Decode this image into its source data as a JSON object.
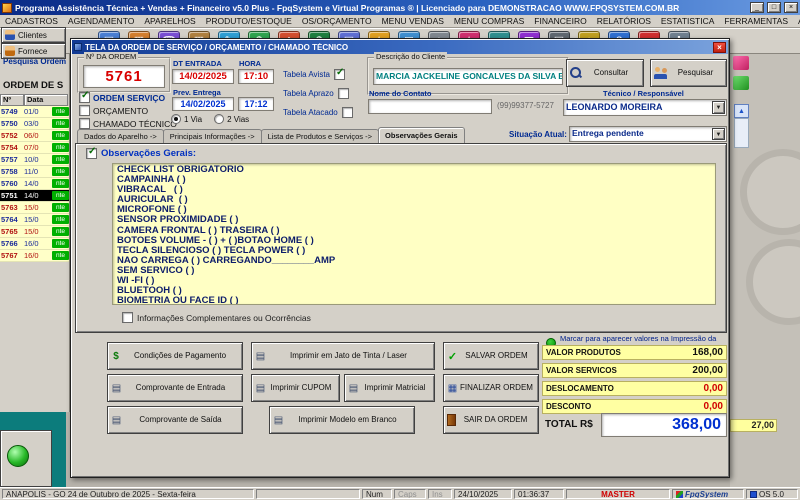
{
  "window": {
    "title": "Programa Assistência Técnica + Vendas + Financeiro v5.0 Plus - FpqSystem e Virtual Programas ® | Licenciado para  DEMONSTRACAO WWW.FPQSYSTEM.COM.BR",
    "controls": {
      "minimize": "_",
      "maximize": "□",
      "close": "×"
    }
  },
  "menu": {
    "items": [
      "CADASTROS",
      "AGENDAMENTO",
      "APARELHOS",
      "PRODUTO/ESTOQUE",
      "OS/ORÇAMENTO",
      "MENU VENDAS",
      "MENU COMPRAS",
      "FINANCEIRO",
      "RELATÓRIOS",
      "ESTATISTICA",
      "FERRAMENTAS",
      "AJUDA"
    ]
  },
  "toolbar": {
    "left_buttons": [
      {
        "label": "Clientes"
      },
      {
        "label": "Fornece"
      }
    ],
    "icons": [
      {
        "name": "agenda-icon",
        "glyph": "▤",
        "color": "#4a7fd4"
      },
      {
        "name": "calendar-icon",
        "glyph": "▦",
        "color": "#d47f2f"
      },
      {
        "name": "phone-icon",
        "glyph": "☎",
        "color": "#7a4fd4"
      },
      {
        "name": "stock-icon",
        "glyph": "▥",
        "color": "#b08040"
      },
      {
        "name": "order-icon",
        "glyph": "✎",
        "color": "#2f9fd4"
      },
      {
        "name": "sales-icon",
        "glyph": "$",
        "color": "#2fa44f"
      },
      {
        "name": "purchases-icon",
        "glyph": "◆",
        "color": "#d44f2f"
      },
      {
        "name": "finance-icon",
        "glyph": "$",
        "color": "#1f7f3f"
      },
      {
        "name": "reports-icon",
        "glyph": "▤",
        "color": "#5f6fd4"
      },
      {
        "name": "stats-icon",
        "glyph": "★",
        "color": "#e0a020"
      },
      {
        "name": "mail-icon",
        "glyph": "✉",
        "color": "#3f8fd0"
      },
      {
        "name": "tools-icon",
        "glyph": "+",
        "color": "#808890"
      },
      {
        "name": "star-icon",
        "glyph": "★",
        "color": "#d02f6f"
      },
      {
        "name": "home-icon",
        "glyph": "⌂",
        "color": "#2f8f8f"
      },
      {
        "name": "chart-icon",
        "glyph": "▆",
        "color": "#8f2fd0"
      },
      {
        "name": "print-icon",
        "glyph": "▤",
        "color": "#606870"
      },
      {
        "name": "key-icon",
        "glyph": "♦",
        "color": "#c0a020"
      },
      {
        "name": "help-icon",
        "glyph": "?",
        "color": "#2f6fd0"
      },
      {
        "name": "exit-icon",
        "glyph": "●",
        "color": "#d02f2f"
      },
      {
        "name": "gear-icon",
        "glyph": "✚",
        "color": "#708090"
      }
    ]
  },
  "glyphs": {
    "money": "$",
    "receipt": "▤",
    "printer": "▤",
    "check": "✓",
    "calculator": "▦",
    "arrow_down": "▼",
    "scroll_up": "▲"
  },
  "background": {
    "search_label": "Pesquisa Ordem",
    "list_title": "ORDEM DE S",
    "col_num": "Nº",
    "col_data": "Data",
    "chip": "nte",
    "fragment_value": "27,00",
    "rows": [
      {
        "num": "5749",
        "date": "01/0",
        "chip": "nte"
      },
      {
        "num": "5750",
        "date": "03/0",
        "chip": "nte"
      },
      {
        "num": "5752",
        "date": "06/0",
        "chip": "nte",
        "red": true
      },
      {
        "num": "5754",
        "date": "07/0",
        "chip": "nte",
        "red": true
      },
      {
        "num": "5757",
        "date": "10/0",
        "chip": "nte"
      },
      {
        "num": "5758",
        "date": "11/0",
        "chip": "nte"
      },
      {
        "num": "5760",
        "date": "14/0",
        "chip": "nte"
      },
      {
        "num": "5751",
        "date": "14/0",
        "chip": "nte",
        "selected": true
      },
      {
        "num": "5763",
        "date": "15/0",
        "chip": "nte",
        "red": true
      },
      {
        "num": "5764",
        "date": "15/0",
        "chip": "nte"
      },
      {
        "num": "5765",
        "date": "15/0",
        "chip": "nte",
        "red": true
      },
      {
        "num": "5766",
        "date": "16/0",
        "chip": "nte"
      },
      {
        "num": "5767",
        "date": "16/0",
        "chip": "nte",
        "red": true
      }
    ]
  },
  "dialog": {
    "title": "TELA DA ORDEM DE SERVIÇO / ORÇAMENTO / CHAMADO TÉCNICO",
    "close": "×",
    "order_label": "Nº DA ORDEM",
    "order_number": "5761",
    "dt_entrada_label": "DT ENTRADA",
    "hora_label": "HORA",
    "entry_date": "14/02/2025",
    "entry_time": "17:10",
    "type_checks": [
      {
        "label": "ORDEM SERVIÇO",
        "checked": true
      },
      {
        "label": "ORÇAMENTO"
      },
      {
        "label": "CHAMADO TÉCNICO"
      }
    ],
    "prev_label": "Prev. Entrega",
    "prev_date": "14/02/2025",
    "prev_time": "17:12",
    "vias": [
      {
        "label": "1 Via",
        "selected": true
      },
      {
        "label": "2 Vias"
      }
    ],
    "tabelas": [
      {
        "label": "Tabela Avista",
        "checked": true
      },
      {
        "label": "Tabela Aprazo"
      },
      {
        "label": "Tabela Atacado"
      }
    ],
    "client_group_label": "Descrição do Cliente",
    "client_name": "MARCIA JACKELINE GONCALVES DA SILVA BE",
    "contact_label": "Nome do Contato",
    "contact_value": "",
    "contact_phone": "(99)99377-5727",
    "consult_button": "Consultar",
    "search_button": "Pesquisar",
    "technician_label": "Técnico / Responsável",
    "technician": "LEONARDO MOREIRA",
    "tabs": [
      {
        "label": "Dados do Aparelho ->"
      },
      {
        "label": "Principais Informações ->"
      },
      {
        "label": "Lista de Produtos e Serviços ->"
      },
      {
        "label": "Observações Gerais",
        "active": true
      }
    ],
    "situation_label": "Situação Atual:",
    "situation": "Entrega pendente",
    "obs_checkbox": "Observações Gerais:",
    "obs_text": "CHECK LIST OBRIGATORIO\nCAMPAINHA ( )\nVIBRACAL   ( )\nAURICULAR  ( )\nMICROFONE ( )\nSENSOR PROXIMIDADE ( )\nCAMERA FRONTAL ( ) TRASEIRA ( )\nBOTOES VOLUME - ( ) + ( )BOTAO HOME ( )\nTECLA SILENCIOSO ( ) TECLA POWER ( )\nNAO CARREGA ( ) CARREGANDO________AMP\nSEM SERVICO ( )\nWI -FI ( )\nBLUETOOH ( )\nBIOMETRIA OU FACE ID ( )",
    "complementary_checkbox": "Informações Complementares ou Ocorrências",
    "print_values_radio": "Marcar para aparecer valores na Impressão da OS",
    "buttons": {
      "payment": "Condições de Pagamento",
      "receipt_in": "Comprovante de Entrada",
      "receipt_out": "Comprovante de Saída",
      "print_laser": "Imprimir em Jato de Tinta / Laser",
      "print_coupon": "Imprimir CUPOM",
      "print_matrix": "Imprimir Matricial",
      "print_blank": "Imprimir Modelo em Branco",
      "save": "SALVAR ORDEM",
      "finish": "FINALIZAR ORDEM",
      "exit": "SAIR DA ORDEM"
    },
    "totals": [
      {
        "label": "VALOR PRODUTOS",
        "value": "168,00"
      },
      {
        "label": "VALOR SERVICOS",
        "value": "200,00"
      },
      {
        "label": "DESLOCAMENTO",
        "value": "0,00",
        "red": true
      },
      {
        "label": "DESCONTO",
        "value": "0,00",
        "red": true
      }
    ],
    "total_label": "TOTAL R$",
    "total_value": "368,00"
  },
  "statusbar": {
    "location": "ANAPOLIS - GO 24 de Outubro de 2025 - Sexta-feira",
    "num": "Num",
    "caps": "Caps",
    "ins": "Ins",
    "date": "24/10/2025",
    "time": "01:36:37",
    "user": "MASTER",
    "brand": "FpqSystem",
    "version": "OS 5.0"
  }
}
